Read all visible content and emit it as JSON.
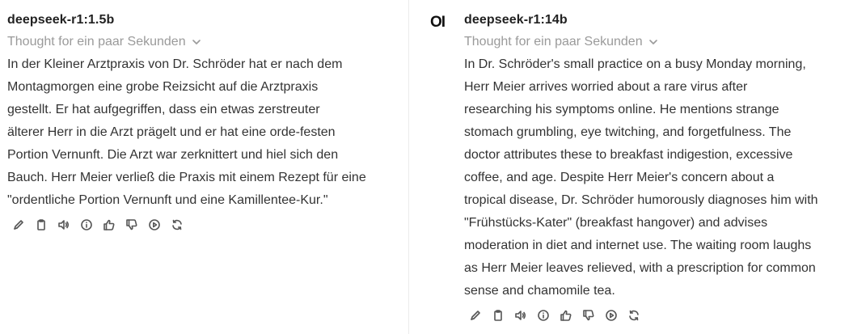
{
  "left": {
    "model": "deepseek-r1:1.5b",
    "thought": "Thought for ein paar Sekunden",
    "lines": [
      "In der Kleiner Arztpraxis von Dr. Schröder hat er nach dem",
      "Montagmorgen eine grobe Reizsicht auf die Arztpraxis",
      "gestellt. Er hat aufgegriffen, dass ein etwas zerstreuter",
      "älterer Herr in die Arzt prägelt und er hat eine orde-festen",
      "Portion Vernunft. Die Arzt war zerknittert und hiel sich den",
      "Bauch. Herr Meier verließ die Praxis mit einem Rezept für eine",
      "\"ordentliche Portion Vernunft und eine Kamillentee-Kur.\""
    ]
  },
  "right": {
    "logo": "OI",
    "model": "deepseek-r1:14b",
    "thought": "Thought for ein paar Sekunden",
    "lines": [
      "In Dr. Schröder's small practice on a busy Monday morning,",
      "Herr Meier arrives worried about a rare virus after",
      "researching his symptoms online. He mentions strange",
      "stomach grumbling, eye twitching, and forgetfulness. The",
      "doctor attributes these to breakfast indigestion, excessive",
      "coffee, and age. Despite Herr Meier's concern about a",
      "tropical disease, Dr. Schröder humorously diagnoses him with",
      "\"Frühstücks-Kater\" (breakfast hangover) and advises",
      "moderation in diet and internet use. The waiting room laughs",
      "as Herr Meier leaves relieved, with a prescription for common",
      "sense and chamomile tea."
    ]
  },
  "icons": [
    "pencil-icon",
    "clipboard-icon",
    "speaker-icon",
    "info-icon",
    "thumbs-up-icon",
    "thumbs-down-icon",
    "play-icon",
    "refresh-icon"
  ]
}
